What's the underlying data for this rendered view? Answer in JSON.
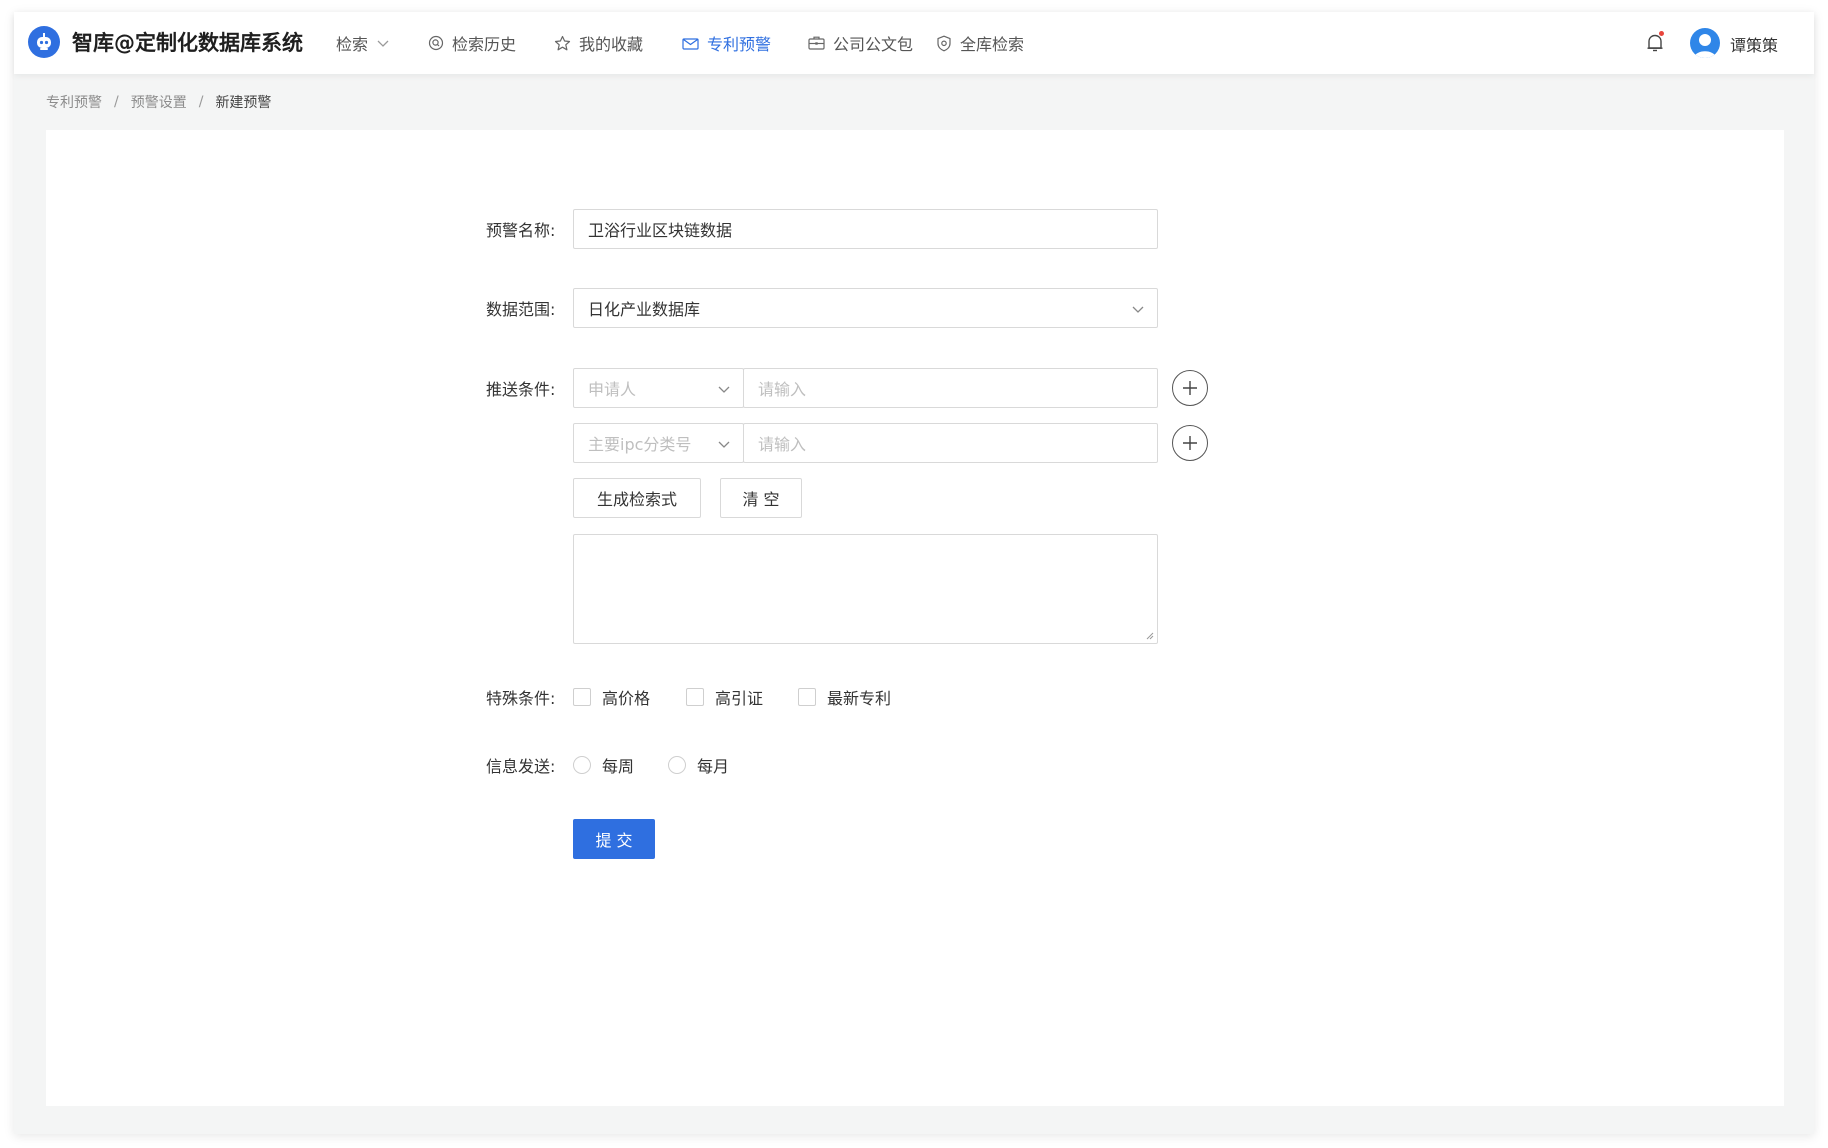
{
  "header": {
    "brand": "智库@定制化数据库系统",
    "logo_icon": "robot-logo-icon",
    "nav": [
      {
        "label": "检索",
        "icon": "chevron-down-icon"
      },
      {
        "label": "检索历史",
        "icon": "history-search-icon"
      },
      {
        "label": "我的收藏",
        "icon": "star-icon"
      },
      {
        "label": "专利预警",
        "icon": "mail-icon",
        "active": true
      },
      {
        "label": "公司公文包",
        "icon": "briefcase-icon"
      },
      {
        "label": "全库检索",
        "icon": "shield-icon"
      }
    ],
    "username": "谭策策",
    "accent_color": "#2f6fe0",
    "notification_dot_color": "#e8453c"
  },
  "breadcrumb": {
    "items": [
      "专利预警",
      "预警设置",
      "新建预警"
    ],
    "separator": "/"
  },
  "form": {
    "name_label": "预警名称:",
    "name_value": "卫浴行业区块链数据",
    "scope_label": "数据范围:",
    "scope_value": "日化产业数据库",
    "push_label": "推送条件:",
    "conditions": [
      {
        "field_placeholder": "申请人",
        "value_placeholder": "请输入"
      },
      {
        "field_placeholder": "主要ipc分类号",
        "value_placeholder": "请输入"
      }
    ],
    "generate_button": "生成检索式",
    "clear_button": "清 空",
    "special_label": "特殊条件:",
    "special_options": [
      "高价格",
      "高引证",
      "最新专利"
    ],
    "send_label": "信息发送:",
    "send_options": [
      "每周",
      "每月"
    ],
    "submit_button": "提 交"
  }
}
